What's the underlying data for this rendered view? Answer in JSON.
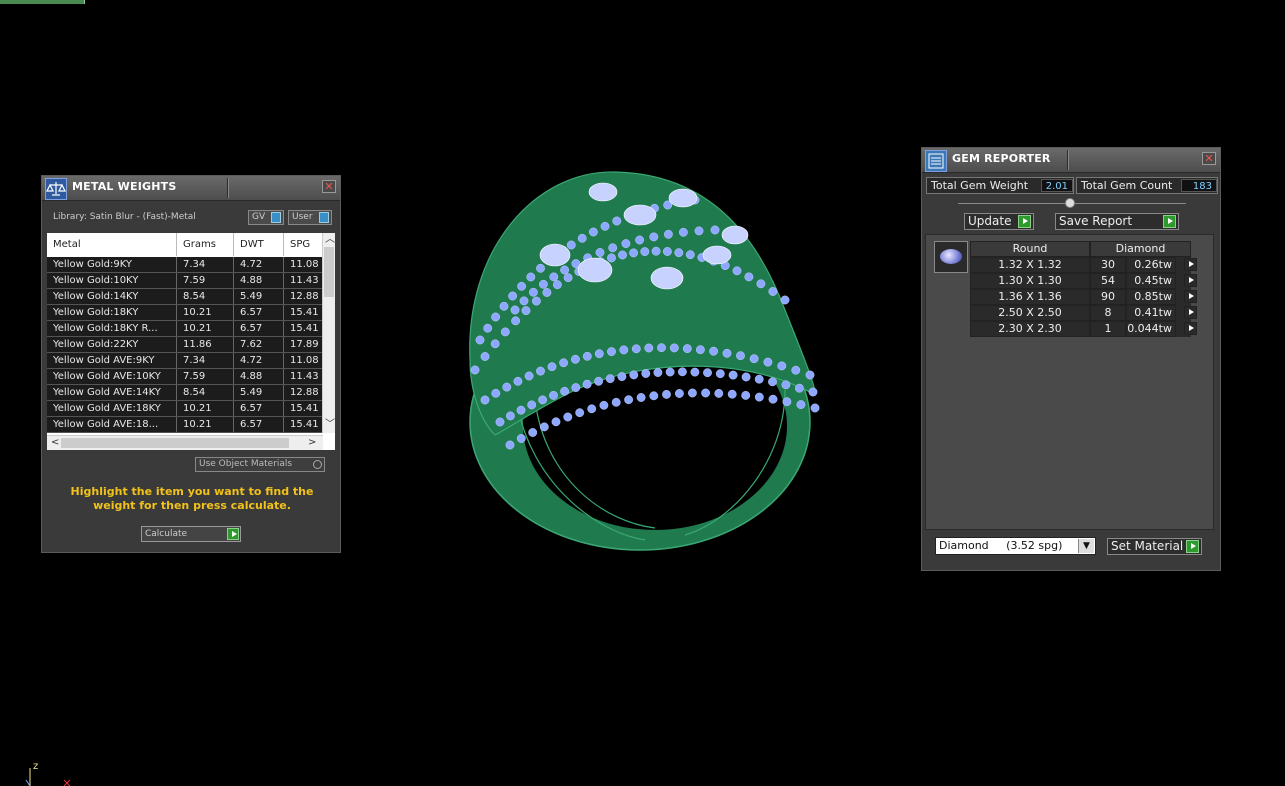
{
  "metal_weights": {
    "title": "METAL WEIGHTS",
    "library_label": "Library: Satin Blur - (Fast)-Metal",
    "gv_label": "GV",
    "user_label": "User",
    "columns": [
      "Metal",
      "Grams",
      "DWT",
      "SPG"
    ],
    "rows": [
      {
        "metal": "Yellow Gold:9KY",
        "grams": "7.34",
        "dwt": "4.72",
        "spg": "11.08"
      },
      {
        "metal": "Yellow Gold:10KY",
        "grams": "7.59",
        "dwt": "4.88",
        "spg": "11.43"
      },
      {
        "metal": "Yellow Gold:14KY",
        "grams": "8.54",
        "dwt": "5.49",
        "spg": "12.88"
      },
      {
        "metal": "Yellow Gold:18KY",
        "grams": "10.21",
        "dwt": "6.57",
        "spg": "15.41"
      },
      {
        "metal": "Yellow Gold:18KY R...",
        "grams": "10.21",
        "dwt": "6.57",
        "spg": "15.41"
      },
      {
        "metal": "Yellow Gold:22KY",
        "grams": "11.86",
        "dwt": "7.62",
        "spg": "17.89"
      },
      {
        "metal": "Yellow Gold AVE:9KY",
        "grams": "7.34",
        "dwt": "4.72",
        "spg": "11.08"
      },
      {
        "metal": "Yellow Gold AVE:10KY",
        "grams": "7.59",
        "dwt": "4.88",
        "spg": "11.43"
      },
      {
        "metal": "Yellow Gold AVE:14KY",
        "grams": "8.54",
        "dwt": "5.49",
        "spg": "12.88"
      },
      {
        "metal": "Yellow Gold AVE:18KY",
        "grams": "10.21",
        "dwt": "6.57",
        "spg": "15.41"
      },
      {
        "metal": "Yellow Gold AVE:18...",
        "grams": "10.21",
        "dwt": "6.57",
        "spg": "15.41"
      }
    ],
    "use_object_materials": "Use Object Materials",
    "hint": "Highlight the item you want to find the weight for then press calculate.",
    "calculate_label": "Calculate"
  },
  "gem_reporter": {
    "title": "GEM REPORTER",
    "total_weight_label": "Total Gem Weight",
    "total_weight_value": "2.01",
    "total_count_label": "Total Gem Count",
    "total_count_value": "183",
    "update_label": "Update",
    "save_report_label": "Save Report",
    "shape_header": "Round",
    "material_header": "Diamond",
    "gems": [
      {
        "size": "1.32 X 1.32",
        "count": "30",
        "weight": "0.26tw"
      },
      {
        "size": "1.30 X 1.30",
        "count": "54",
        "weight": "0.45tw"
      },
      {
        "size": "1.36 X 1.36",
        "count": "90",
        "weight": "0.85tw"
      },
      {
        "size": "2.50 X 2.50",
        "count": "8",
        "weight": "0.41tw"
      },
      {
        "size": "2.30 X 2.30",
        "count": "1",
        "weight": "0.044tw"
      }
    ],
    "material_select": "Diamond     (3.52 spg)",
    "set_material_label": "Set Material"
  },
  "viewport": {
    "axis_label": "z"
  },
  "colors": {
    "metal_green": "#1f7a4e",
    "gem_blue": "#8fa8ff",
    "hint_yellow": "#f2c21a",
    "play_green": "#2e9a2e"
  }
}
